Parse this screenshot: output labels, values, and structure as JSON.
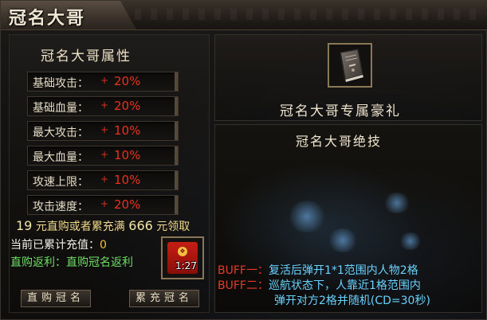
{
  "header": {
    "title": "冠名大哥"
  },
  "attributes": {
    "title": "冠名大哥属性",
    "plus_sign": "+",
    "rows": [
      {
        "label": "基础攻击：",
        "value": "20%"
      },
      {
        "label": "基础血量：",
        "value": "20%"
      },
      {
        "label": "最大攻击：",
        "value": "10%"
      },
      {
        "label": "最大血量：",
        "value": "10%"
      },
      {
        "label": "攻速上限：",
        "value": "10%"
      },
      {
        "label": "攻击速度：",
        "value": "20%"
      }
    ]
  },
  "promo": {
    "amount_direct": "19",
    "text_a": "元直购或者累充满",
    "amount_total": "666",
    "text_b": "元领取"
  },
  "recharge": {
    "label": "当前已累计充值：",
    "value": "0"
  },
  "rebate": {
    "text": "直购返利：直购冠名返利"
  },
  "reward_item": {
    "count": "1:27"
  },
  "buttons": {
    "direct_buy": "直购冠名",
    "accumulate": "累充冠名"
  },
  "gift": {
    "title": "冠名大哥专属豪礼"
  },
  "skill": {
    "title": "冠名大哥绝技",
    "buffs": [
      {
        "label": "BUFF一：",
        "desc": "复活后弹开1*1范围内人物2格"
      },
      {
        "label": "BUFF二：",
        "desc": "巡航状态下，人靠近1格范围内"
      },
      {
        "label": "",
        "desc": "弹开对方2格并随机(CD=30秒)"
      }
    ]
  },
  "colors": {
    "value_red": "#e8321c",
    "promo_gold": "#f0d98c",
    "rebate_green": "#6fdc64",
    "buff_blue": "#6ad2ff",
    "buff_red": "#e63a26"
  }
}
